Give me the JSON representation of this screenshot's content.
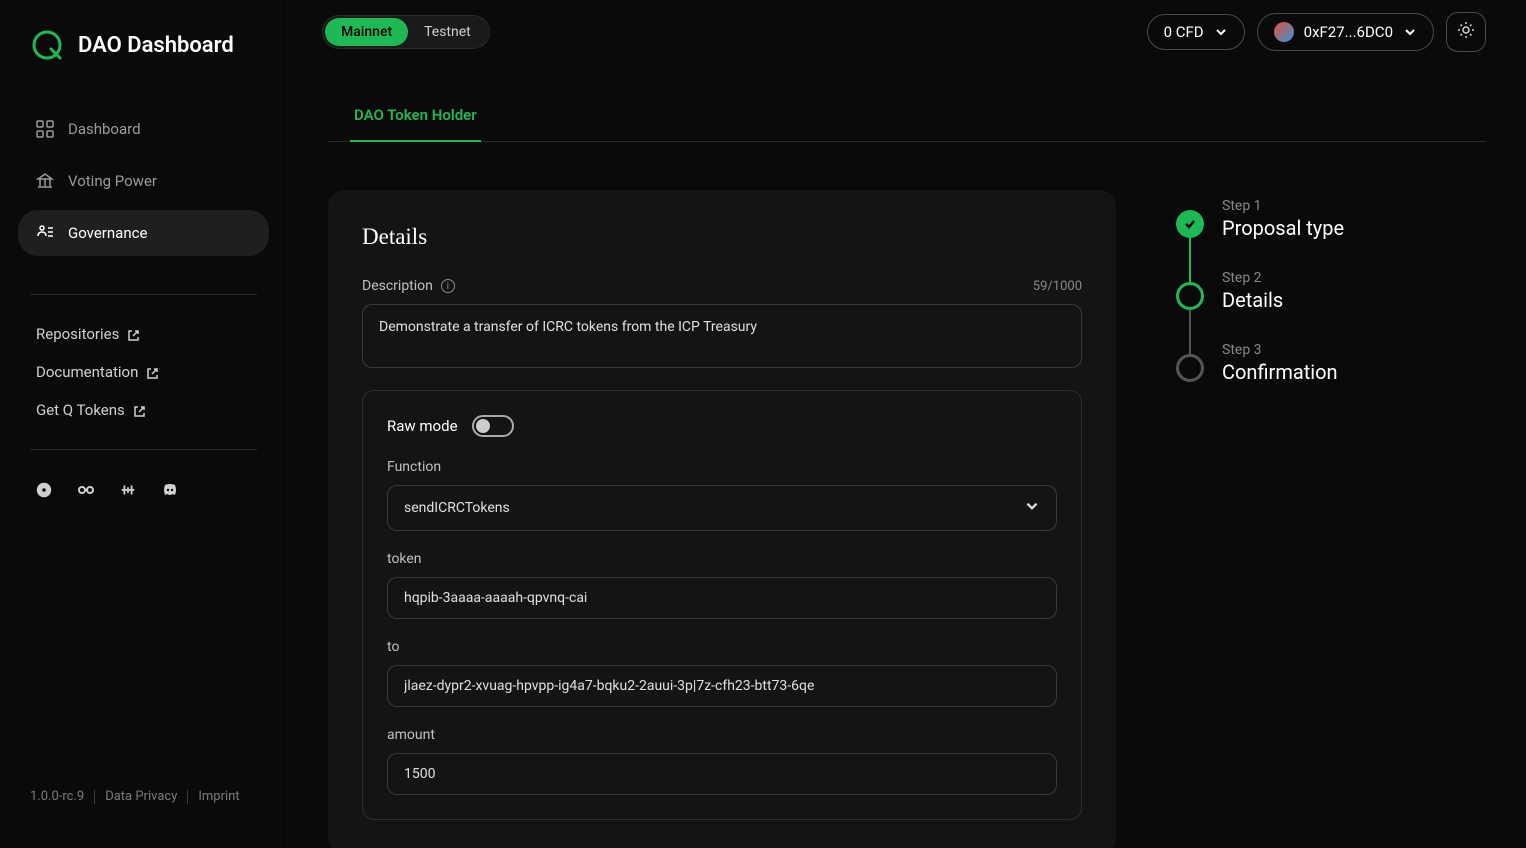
{
  "brand": {
    "title": "DAO Dashboard"
  },
  "nav": {
    "dashboard": "Dashboard",
    "voting_power": "Voting Power",
    "governance": "Governance"
  },
  "links": {
    "repositories": "Repositories",
    "documentation": "Documentation",
    "get_tokens": "Get Q Tokens"
  },
  "footer": {
    "version": "1.0.0-rc.9",
    "privacy": "Data Privacy",
    "imprint": "Imprint"
  },
  "topbar": {
    "mainnet": "Mainnet",
    "testnet": "Testnet",
    "balance": "0 CFD",
    "address": "0xF27...6DC0"
  },
  "tab": {
    "label": "DAO Token Holder"
  },
  "details": {
    "title": "Details",
    "description_label": "Description",
    "counter": "59/1000",
    "description_value": "Demonstrate a transfer of ICRC tokens from the ICP Treasury",
    "raw_mode_label": "Raw mode",
    "function_label": "Function",
    "function_value": "sendICRCTokens",
    "token_label": "token",
    "token_value": "hqpib-3aaaa-aaaah-qpvnq-cai",
    "to_label": "to",
    "to_value": "jlaez-dypr2-xvuag-hpvpp-ig4a7-bqku2-2auui-3p|7z-cfh23-btt73-6qe",
    "amount_label": "amount",
    "amount_value": "1500"
  },
  "steps": {
    "s1_num": "Step 1",
    "s1_title": "Proposal type",
    "s2_num": "Step 2",
    "s2_title": "Details",
    "s3_num": "Step 3",
    "s3_title": "Confirmation"
  }
}
